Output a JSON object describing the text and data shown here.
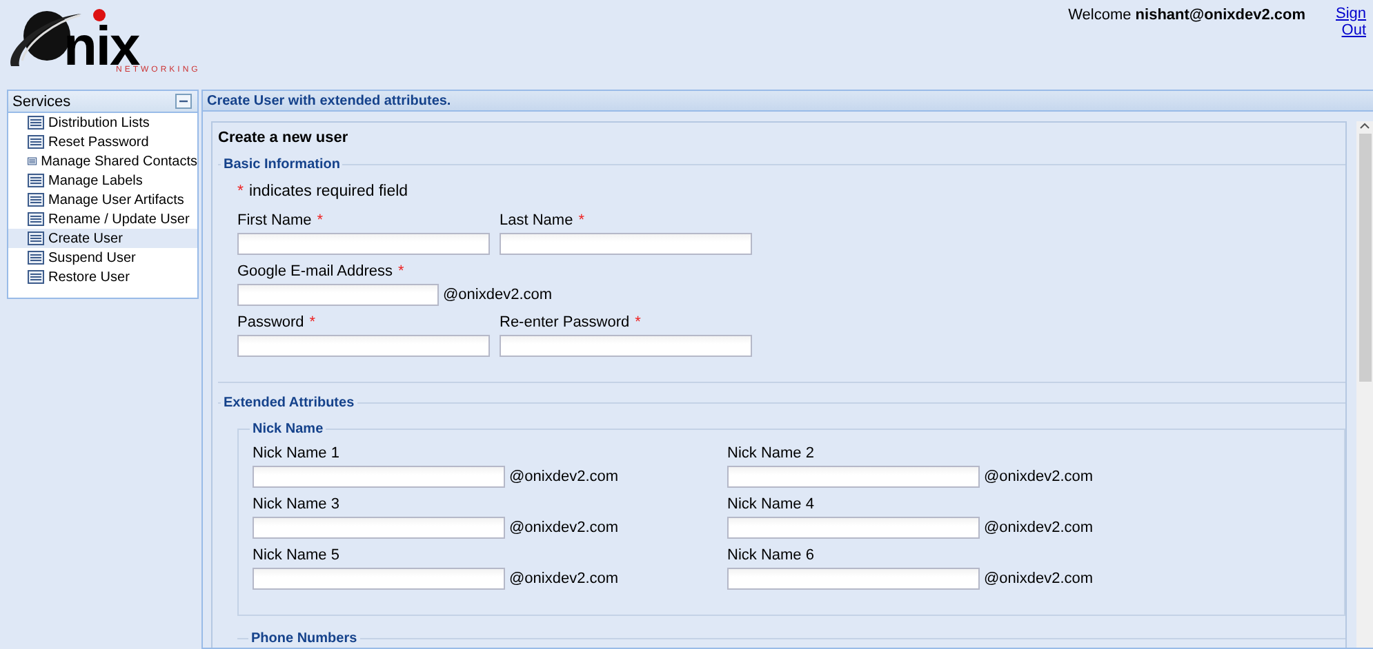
{
  "header": {
    "logo_text": "nix",
    "logo_tagline": "NETWORKING",
    "welcome": "Welcome **nishant@onixdev2.com**",
    "sign_out": "Sign Out"
  },
  "sidebar": {
    "title": "Services",
    "items": [
      {
        "label": "Distribution Lists",
        "selected": false
      },
      {
        "label": "Reset Password",
        "selected": false
      },
      {
        "label": "Manage Shared Contacts",
        "selected": false
      },
      {
        "label": "Manage Labels",
        "selected": false
      },
      {
        "label": "Manage User Artifacts",
        "selected": false
      },
      {
        "label": "Rename / Update User",
        "selected": false
      },
      {
        "label": "Create User",
        "selected": true
      },
      {
        "label": "Suspend User",
        "selected": false
      },
      {
        "label": "Restore User",
        "selected": false
      }
    ]
  },
  "main": {
    "panel_title": "Create User with extended attributes.",
    "form_title": "Create a new user",
    "basic_information": {
      "legend": "Basic Information",
      "required_mark": "*",
      "required_note": "indicates required field",
      "rows": [
        [
          {
            "label": "First Name",
            "required": true
          },
          {
            "label": "Last Name",
            "required": true
          }
        ],
        [
          {
            "label": "Google E-mail Address",
            "required": true,
            "suffix": "@onixdev2.com"
          }
        ],
        [
          {
            "label": "Password",
            "required": true
          },
          {
            "label": "Re-enter Password",
            "required": true
          }
        ]
      ]
    },
    "extended_attributes": {
      "legend": "Extended Attributes",
      "nick_name": {
        "legend": "Nick Name",
        "rows": [
          [
            {
              "label": "Nick Name 1",
              "suffix": "@onixdev2.com"
            },
            {
              "label": "Nick Name 2",
              "suffix": "@onixdev2.com"
            }
          ],
          [
            {
              "label": "Nick Name 3",
              "suffix": "@onixdev2.com"
            },
            {
              "label": "Nick Name 4",
              "suffix": "@onixdev2.com"
            }
          ],
          [
            {
              "label": "Nick Name 5",
              "suffix": "@onixdev2.com"
            },
            {
              "label": "Nick Name 6",
              "suffix": "@onixdev2.com"
            }
          ]
        ]
      },
      "phone_numbers": {
        "legend": "Phone Numbers"
      }
    }
  }
}
